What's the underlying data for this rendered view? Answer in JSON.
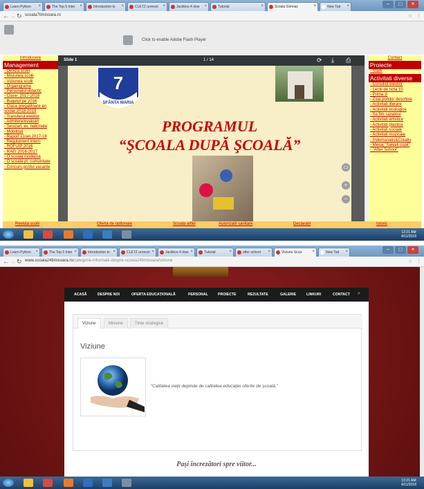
{
  "shot1": {
    "tabs": [
      {
        "label": "Learn Python"
      },
      {
        "label": "The Top 5 Inter"
      },
      {
        "label": "Introduction to"
      },
      {
        "label": "CLETZ unresol"
      },
      {
        "label": "Jackboo 4 dow"
      },
      {
        "label": "Tutorial"
      },
      {
        "label": "Scoala Gimnaz"
      },
      {
        "label": "New Tab"
      }
    ],
    "url": "scoala7timisoara.ro",
    "flash_text": "Click to enable Adobe Flash Player",
    "left_nav": {
      "top_link": "Introducere",
      "header": "Management",
      "links": [
        "- Deviza scolii",
        "- Misiunea scolii",
        "- Viziunea scolii",
        "- Organigrama",
        "- Personalul didactic",
        "- Clase: 2017-2018",
        "- Bugetul pe 2016",
        "- Clasa pregatitoare an scolar 2018-2019",
        "- Transferul elevilor",
        "- Admitere/evaluari",
        "- Sesizari: ev. nationala",
        "- Mobilitati",
        "- Raport s1/an 2017-18",
        "- Regulament intern",
        "- ROFUIP 2016",
        "- RAEI 2016-2017",
        "- O scoala moderna",
        "- O scoala pt. comunitate",
        "- Concurs postul vacante"
      ]
    },
    "right_nav": {
      "top_link": "Contact",
      "header1": "Proiecte",
      "link1": "- Starti",
      "header2": "Activitati diverse",
      "links": [
        "- Consiliul elevilor",
        "- Lectii de nota 10",
        "- Prima zi",
        "- Ziua portilor deschise",
        "- Activitati literare",
        "- Activitati ecologice",
        "- Sa fim sanatosi",
        "- Activitati artistice",
        "- Activitati plastice",
        "- Activitati sociale",
        "- Activitati muzicale",
        "- Indemanatic&Creativ",
        "- Mesaj \"Salvati copii\"",
        "- \"After School\""
      ]
    },
    "viewer": {
      "title": "Slide 1",
      "page": "1 / 14",
      "logo_number": "7",
      "logo_text": "SFÂNTA MARIA",
      "heading1": "PROGRAMUL",
      "heading2": "“ŞCOALA DUPĂ ŞCOALĂ”"
    },
    "bottom_links": [
      "Revista scolii",
      "Oferta de optionale",
      "Scoala altfel",
      "Autorizatii sanitare",
      "Declaratii",
      "Istoric"
    ],
    "clock": {
      "time": "12:21 AM",
      "date": "4/11/2018"
    }
  },
  "shot2": {
    "tabs": [
      {
        "label": "Learn Python"
      },
      {
        "label": "The Top 5 Inter"
      },
      {
        "label": "Introduction to"
      },
      {
        "label": "CLETZ unresol"
      },
      {
        "label": "Jackboo 4 dow"
      },
      {
        "label": "Tutorial"
      },
      {
        "label": "after school"
      },
      {
        "label": "Viziune Scoa"
      },
      {
        "label": "New Tab"
      }
    ],
    "url_host": "www.scoala24timisoara.ro",
    "url_path": "/categorie-informatii-despre-scoala24timisoara/viziune",
    "menu": [
      "ACASĂ",
      "DESPRE NOI",
      "OFERTA EDUCAȚIONALĂ",
      "PERSONAL",
      "PROIECTE",
      "REZULTATE",
      "GALERIE",
      "LINKURI",
      "CONTACT"
    ],
    "content_tabs": [
      "Viziune",
      "Misiune",
      "Ținte strategice"
    ],
    "vision_title": "Viziune",
    "quote": "“Calitatea vieţii depinde de calitatea educaţiei oferite de şcoală.”",
    "motto": "Paşi încrezători spre viitor...",
    "clock": {
      "time": "12:21 AM",
      "date": "4/11/2018"
    }
  },
  "colors": {
    "nav_red": "#c00000",
    "nav_yellow": "#ffff99",
    "site_maroon": "#7b1414"
  }
}
